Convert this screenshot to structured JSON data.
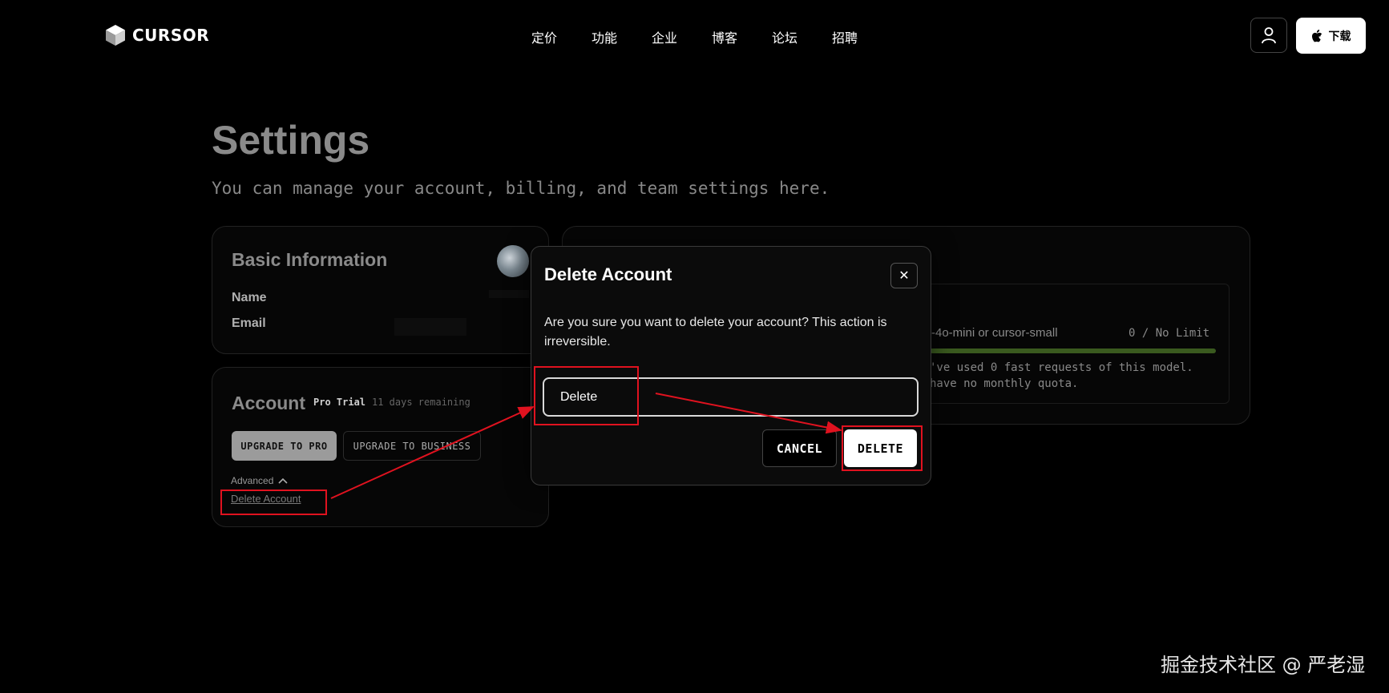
{
  "header": {
    "logo_text": "CURSOR",
    "nav": [
      "定价",
      "功能",
      "企业",
      "博客",
      "论坛",
      "招聘"
    ],
    "download_label": "下载"
  },
  "page": {
    "title": "Settings",
    "subtitle": "You can manage your account, billing, and team settings here."
  },
  "basic_info": {
    "title": "Basic Information",
    "name_label": "Name",
    "email_label": "Email"
  },
  "account": {
    "title": "Account",
    "plan": "Pro Trial",
    "remaining": "11 days remaining",
    "upgrade_pro": "UPGRADE TO PRO",
    "upgrade_business": "UPGRADE TO BUSINESS",
    "advanced": "Advanced",
    "delete_link": "Delete Account"
  },
  "usage": {
    "model": "-4o-mini or cursor-small",
    "value": "0 / No Limit",
    "note_line1": "'ve used 0 fast requests of this model.",
    "note_line2": "have no monthly quota."
  },
  "modal": {
    "title": "Delete Account",
    "close_glyph": "✕",
    "message": "Are you sure you want to delete your account? This action is irreversible.",
    "input_value": "Delete",
    "cancel_label": "CANCEL",
    "delete_label": "DELETE"
  },
  "watermark": "掘金技术社区 @ 严老湿",
  "colors": {
    "annotation": "#e0121f",
    "usage_bar": "#3a5a1f"
  }
}
